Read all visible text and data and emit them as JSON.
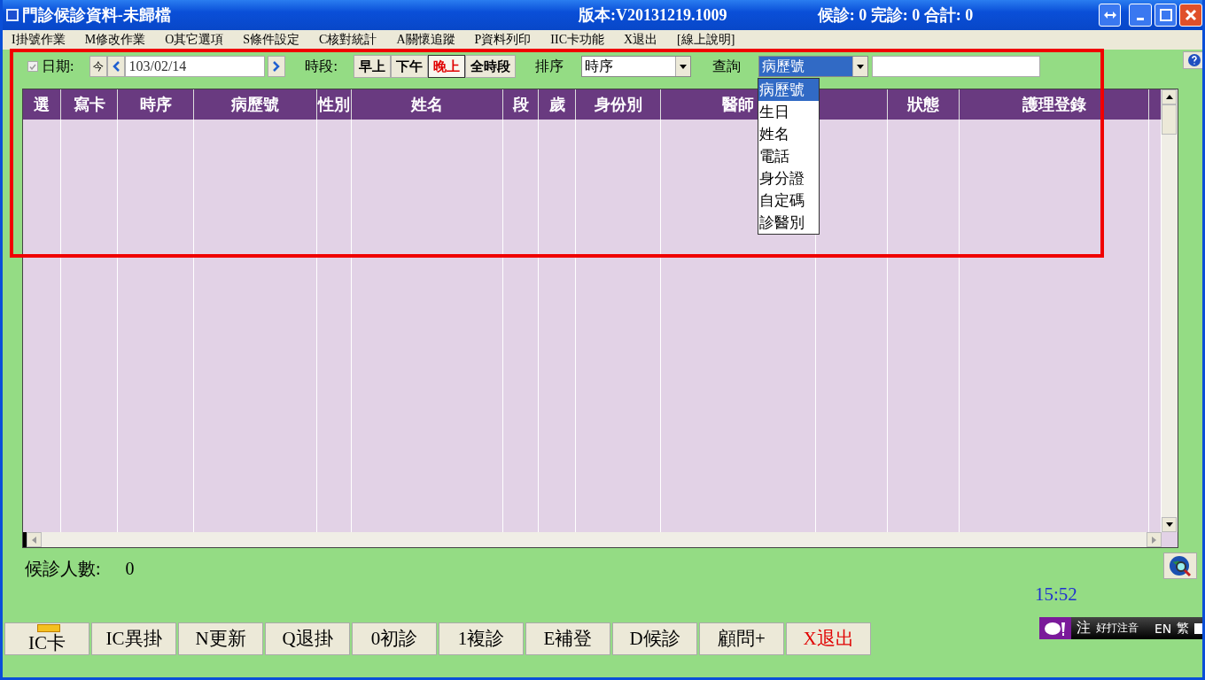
{
  "window": {
    "title": "門診候診資料-未歸檔",
    "version": "版本:V20131219.1009",
    "counts": "候診: 0 完診: 0 合計: 0"
  },
  "menu": [
    "I掛號作業",
    "M修改作業",
    "O其它選項",
    "S條件設定",
    "C核對統計",
    "A關懷追蹤",
    "P資料列印",
    "IIC卡功能",
    "X退出",
    "[線上說明]"
  ],
  "toolbar": {
    "date_checked": true,
    "date_label": "日期:",
    "today": "今",
    "date": "103/02/14",
    "period_label": "時段:",
    "periods": [
      {
        "label": "早上",
        "selected": false
      },
      {
        "label": "下午",
        "selected": false
      },
      {
        "label": "晚上",
        "selected": true
      },
      {
        "label": "全時段",
        "selected": false
      }
    ],
    "sort_label": "排序",
    "sort_value": "時序",
    "query_label": "查詢",
    "query_value": "病歷號",
    "query_options": [
      {
        "label": "病歷號",
        "selected": true
      },
      {
        "label": "生日",
        "selected": false
      },
      {
        "label": "姓名",
        "selected": false
      },
      {
        "label": "電話",
        "selected": false
      },
      {
        "label": "身分證",
        "selected": false
      },
      {
        "label": "自定碼",
        "selected": false
      },
      {
        "label": "診醫別",
        "selected": false
      }
    ]
  },
  "table": {
    "columns": [
      {
        "label": "選"
      },
      {
        "label": "寫卡"
      },
      {
        "label": "時序"
      },
      {
        "label": "病歷號"
      },
      {
        "label": "性別"
      },
      {
        "label": "姓名"
      },
      {
        "label": "段"
      },
      {
        "label": "歲"
      },
      {
        "label": "身份別"
      },
      {
        "label": "醫師"
      },
      {},
      {
        "label": "狀態"
      },
      {
        "label": "護理登錄"
      }
    ]
  },
  "footer": {
    "waiting_label": "候診人數:",
    "waiting_value": "0",
    "time": "15:52"
  },
  "buttons": [
    {
      "label": "IC卡",
      "kind": "card"
    },
    {
      "label": "IC異掛",
      "kind": "plain"
    },
    {
      "label": "N更新",
      "kind": "plain"
    },
    {
      "label": "Q退掛",
      "kind": "plain"
    },
    {
      "label": "0初診",
      "kind": "plain"
    },
    {
      "label": "1複診",
      "kind": "plain"
    },
    {
      "label": "E補登",
      "kind": "plain"
    },
    {
      "label": "D候診",
      "kind": "plain"
    },
    {
      "label": "顧問+",
      "kind": "plain"
    },
    {
      "label": "X退出",
      "kind": "exit"
    }
  ],
  "ime": {
    "mode": "注",
    "name": "好打注音",
    "lang": "EN",
    "script": "繁"
  }
}
